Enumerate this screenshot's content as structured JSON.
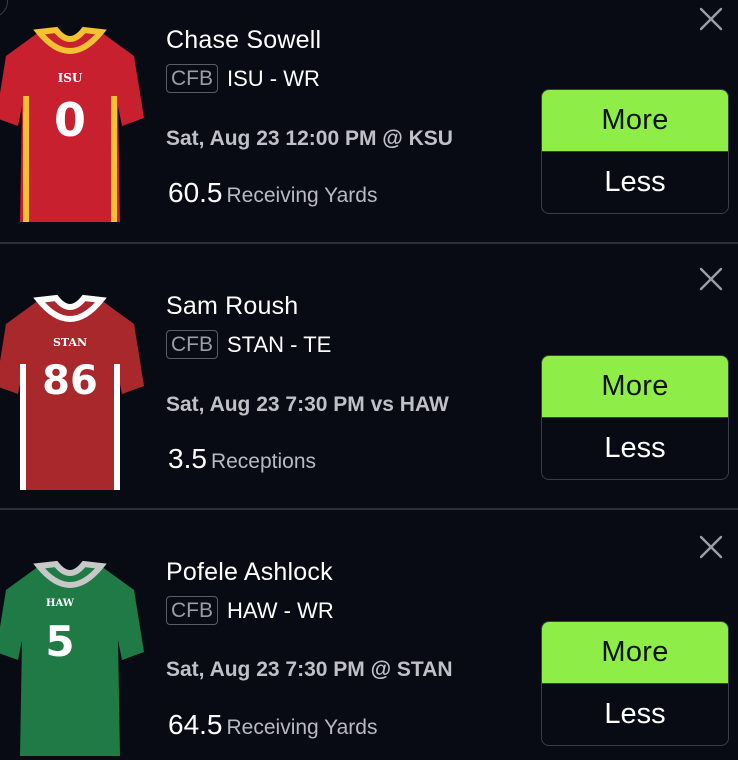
{
  "projections": [
    {
      "player_name": "Chase Sowell",
      "league": "CFB",
      "team_position": "ISU - WR",
      "game_info": "Sat, Aug 23 12:00 PM @ KSU",
      "line_value": "60.5",
      "stat_type": "Receiving Yards",
      "more_label": "More",
      "less_label": "Less",
      "jersey": {
        "team_text": "ISU",
        "number": "0",
        "body_color": "#c8202f",
        "accent_color": "#f2c230",
        "collar_color": "#f2c230"
      }
    },
    {
      "player_name": "Sam Roush",
      "league": "CFB",
      "team_position": "STAN - TE",
      "game_info": "Sat, Aug 23 7:30 PM vs HAW",
      "line_value": "3.5",
      "stat_type": "Receptions",
      "more_label": "More",
      "less_label": "Less",
      "jersey": {
        "team_text": "STAN",
        "number": "86",
        "body_color": "#a8282b",
        "accent_color": "#ffffff",
        "collar_color": "#ffffff"
      }
    },
    {
      "player_name": "Pofele Ashlock",
      "league": "CFB",
      "team_position": "HAW - WR",
      "game_info": "Sat, Aug 23 7:30 PM @ STAN",
      "line_value": "64.5",
      "stat_type": "Receiving Yards",
      "more_label": "More",
      "less_label": "Less",
      "jersey": {
        "team_text": "HAW",
        "number": "5",
        "body_color": "#1f7a45",
        "accent_color": "#c8c8c8",
        "collar_color": "#c8c8c8"
      }
    }
  ],
  "colors": {
    "background": "#090b14",
    "more_button": "#8eee47",
    "divider": "#2d3038"
  },
  "icons": {
    "close": "close-icon"
  }
}
